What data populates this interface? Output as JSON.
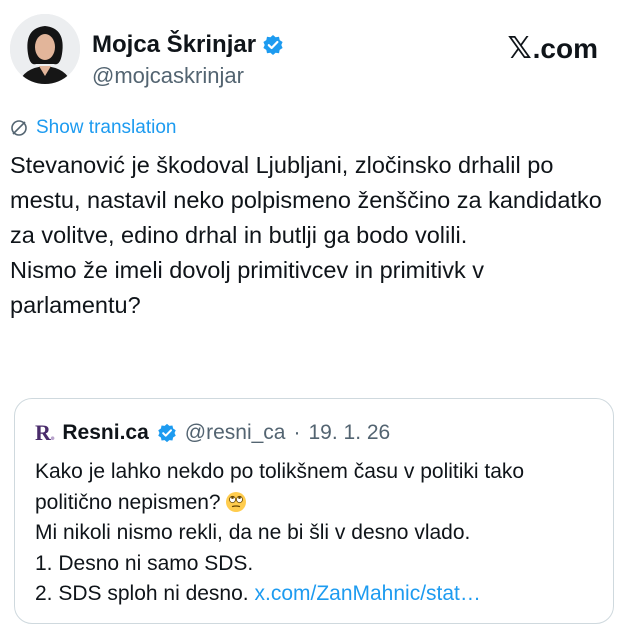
{
  "brand": {
    "mark": "𝕏",
    "suffix": ".com"
  },
  "author": {
    "display_name": "Mojca Škrinjar",
    "handle": "@mojcaskrinjar"
  },
  "translate": {
    "label": "Show translation"
  },
  "tweet": {
    "paragraphs": [
      "Stevanović je škodoval Ljubljani, zločinsko drhalil po mestu, nastavil neko polpismeno ženščino za kandidatko za volitve, edino drhal in butlji ga bodo volili.",
      "Nismo že imeli dovolj primitivcev in primitivk v parlamentu?"
    ]
  },
  "quote": {
    "logo": {
      "letter": "R",
      "dot": "."
    },
    "display_name": "Resni.ca",
    "handle": "@resni_ca",
    "separator": "·",
    "date": "19. 1. 26",
    "lines": [
      "Kako je lahko nekdo po tolikšnem času v politiki tako politično nepismen?",
      "Mi nikoli nismo rekli, da ne bi šli v desno vlado.",
      "1. Desno ni samo SDS.",
      "2. SDS sploh ni desno."
    ],
    "link": "x.com/ZanMahnic/stat…",
    "emoji": "face-with-rolling-eyes-emoji"
  },
  "colors": {
    "accent": "#1d9bf0",
    "verified": "#1d9bf0",
    "secondary_text": "#536471",
    "border": "#cfd9de"
  }
}
